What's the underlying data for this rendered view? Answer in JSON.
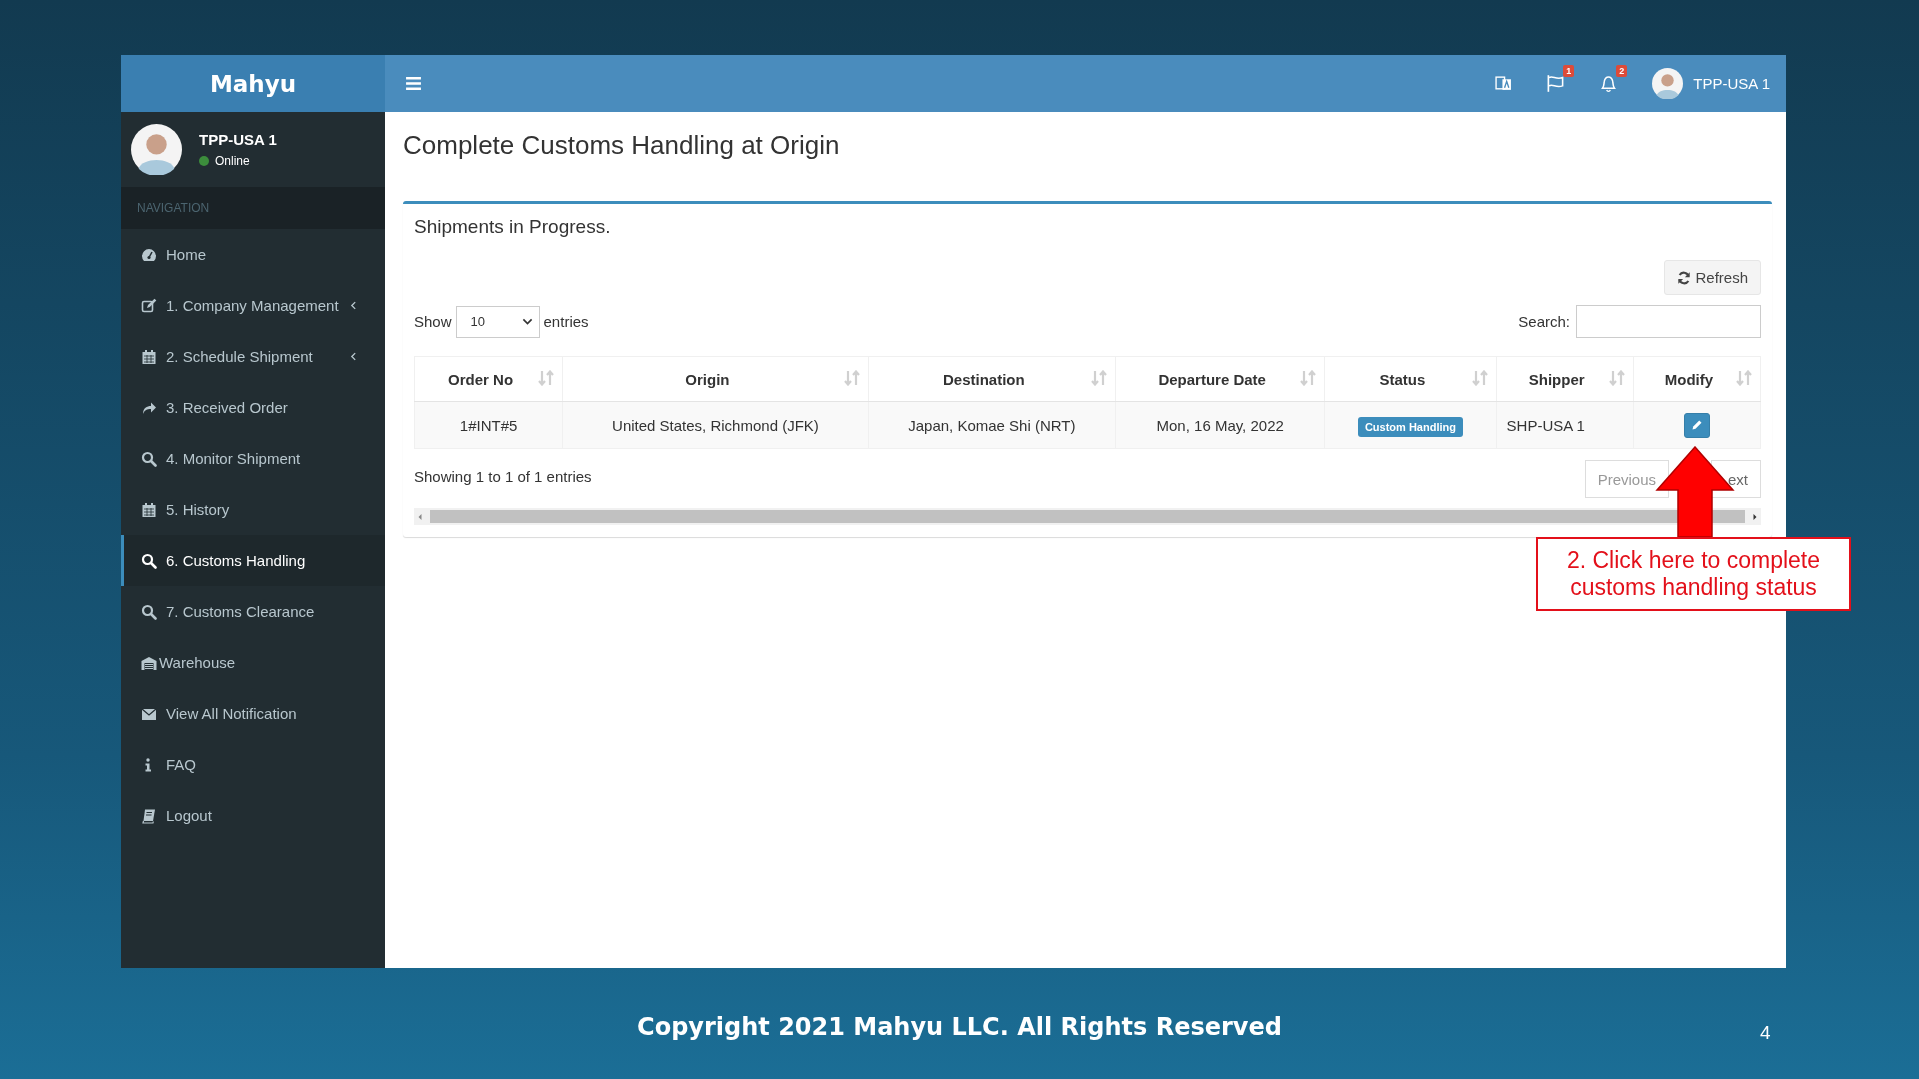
{
  "topbar": {
    "logo": "Mahyu",
    "flag_badge": "1",
    "bell_badge": "2",
    "user_name": "TPP-USA 1"
  },
  "sidebar": {
    "user": {
      "name": "TPP-USA 1",
      "status": "Online"
    },
    "section": "NAVIGATION",
    "items": [
      {
        "label": "Home",
        "selected": false,
        "expandable": false
      },
      {
        "label": "1. Company Management",
        "selected": false,
        "expandable": true
      },
      {
        "label": "2. Schedule Shipment",
        "selected": false,
        "expandable": true
      },
      {
        "label": "3. Received Order",
        "selected": false,
        "expandable": false
      },
      {
        "label": "4. Monitor Shipment",
        "selected": false,
        "expandable": false
      },
      {
        "label": "5. History",
        "selected": false,
        "expandable": false
      },
      {
        "label": "6. Customs Handling",
        "selected": true,
        "expandable": false
      },
      {
        "label": "7. Customs Clearance",
        "selected": false,
        "expandable": false
      },
      {
        "label": "Warehouse",
        "selected": false,
        "expandable": false
      },
      {
        "label": "View All Notification",
        "selected": false,
        "expandable": false
      },
      {
        "label": "FAQ",
        "selected": false,
        "expandable": false
      },
      {
        "label": "Logout",
        "selected": false,
        "expandable": false
      }
    ]
  },
  "content": {
    "title": "Complete Customs Handling at Origin",
    "panel_title": "Shipments in Progress.",
    "refresh": "Refresh",
    "show_label": "Show",
    "page_size": "10",
    "entries_label": "entries",
    "search_label": "Search:",
    "table": {
      "columns": [
        {
          "label": "Order No",
          "kind": "text"
        },
        {
          "label": "Origin",
          "kind": "text"
        },
        {
          "label": "Destination",
          "kind": "text"
        },
        {
          "label": "Departure Date",
          "kind": "text"
        },
        {
          "label": "Status",
          "kind": "badge"
        },
        {
          "label": "Shipper",
          "kind": "text"
        },
        {
          "label": "Modify",
          "kind": "action"
        }
      ],
      "rows": [
        {
          "cells": [
            "1#INT#5",
            "United States, Richmond (JFK)",
            "Japan, Komae Shi (NRT)",
            "Mon, 16 May, 2022",
            "Custom Handling",
            "SHP-USA 1"
          ]
        }
      ]
    },
    "info": "Showing 1 to 1 of 1 entries",
    "previous": "Previous",
    "next": "ext"
  },
  "annotation": {
    "text": "2. Click here to complete customs handling status"
  },
  "footer": {
    "copyright": "Copyright 2021 Mahyu LLC. All Rights Reserved",
    "slide_number": "4"
  }
}
